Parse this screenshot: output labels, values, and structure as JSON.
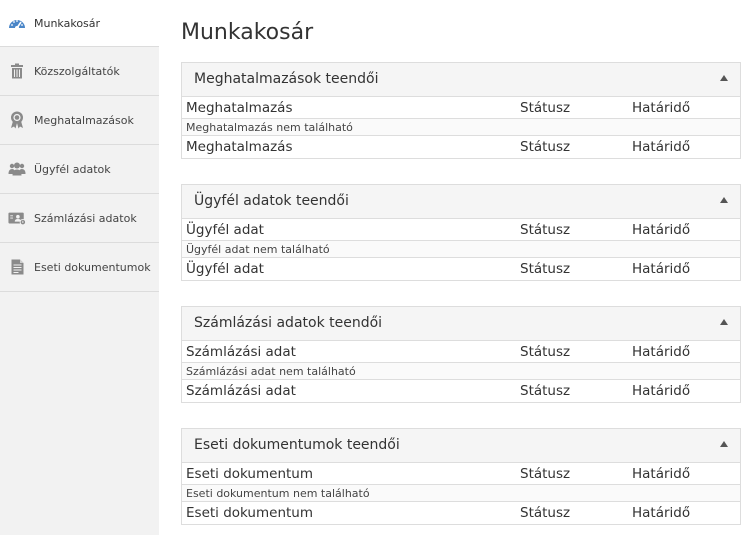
{
  "sidebar": {
    "items": [
      {
        "label": "Munkakosár",
        "icon": "dashboard-icon",
        "active": true
      },
      {
        "label": "Közszolgáltatók",
        "icon": "trash-icon"
      },
      {
        "label": "Meghatalmazások",
        "icon": "award-ribbon-icon"
      },
      {
        "label": "Ügyfél adatok",
        "icon": "users-icon"
      },
      {
        "label": "Számlázási adatok",
        "icon": "billing-card-icon"
      },
      {
        "label": "Eseti dokumentumok",
        "icon": "document-icon"
      }
    ]
  },
  "page": {
    "title": "Munkakosár"
  },
  "colors": {
    "icon_blue": "#4a86c8",
    "icon_gray": "#8a8a8a",
    "sidebar_bg": "#f2f2f2",
    "panel_header_bg": "#f5f5f5"
  },
  "panels": [
    {
      "title": "Meghatalmazások teendői",
      "header_row": {
        "c1": "Meghatalmazás",
        "c2": "Státusz",
        "c3": "Határidő"
      },
      "empty_text": "Meghatalmazás nem található",
      "footer_row": {
        "c1": "Meghatalmazás",
        "c2": "Státusz",
        "c3": "Határidő"
      }
    },
    {
      "title": "Ügyfél adatok teendői",
      "header_row": {
        "c1": "Ügyfél adat",
        "c2": "Státusz",
        "c3": "Határidő"
      },
      "empty_text": "Ügyfél adat nem található",
      "footer_row": {
        "c1": "Ügyfél adat",
        "c2": "Státusz",
        "c3": "Határidő"
      }
    },
    {
      "title": "Számlázási adatok teendői",
      "header_row": {
        "c1": "Számlázási adat",
        "c2": "Státusz",
        "c3": "Határidő"
      },
      "empty_text": "Számlázási adat nem található",
      "footer_row": {
        "c1": "Számlázási adat",
        "c2": "Státusz",
        "c3": "Határidő"
      }
    },
    {
      "title": "Eseti dokumentumok teendői",
      "header_row": {
        "c1": "Eseti dokumentum",
        "c2": "Státusz",
        "c3": "Határidő"
      },
      "empty_text": "Eseti dokumentum nem található",
      "footer_row": {
        "c1": "Eseti dokumentum",
        "c2": "Státusz",
        "c3": "Határidő"
      }
    }
  ]
}
